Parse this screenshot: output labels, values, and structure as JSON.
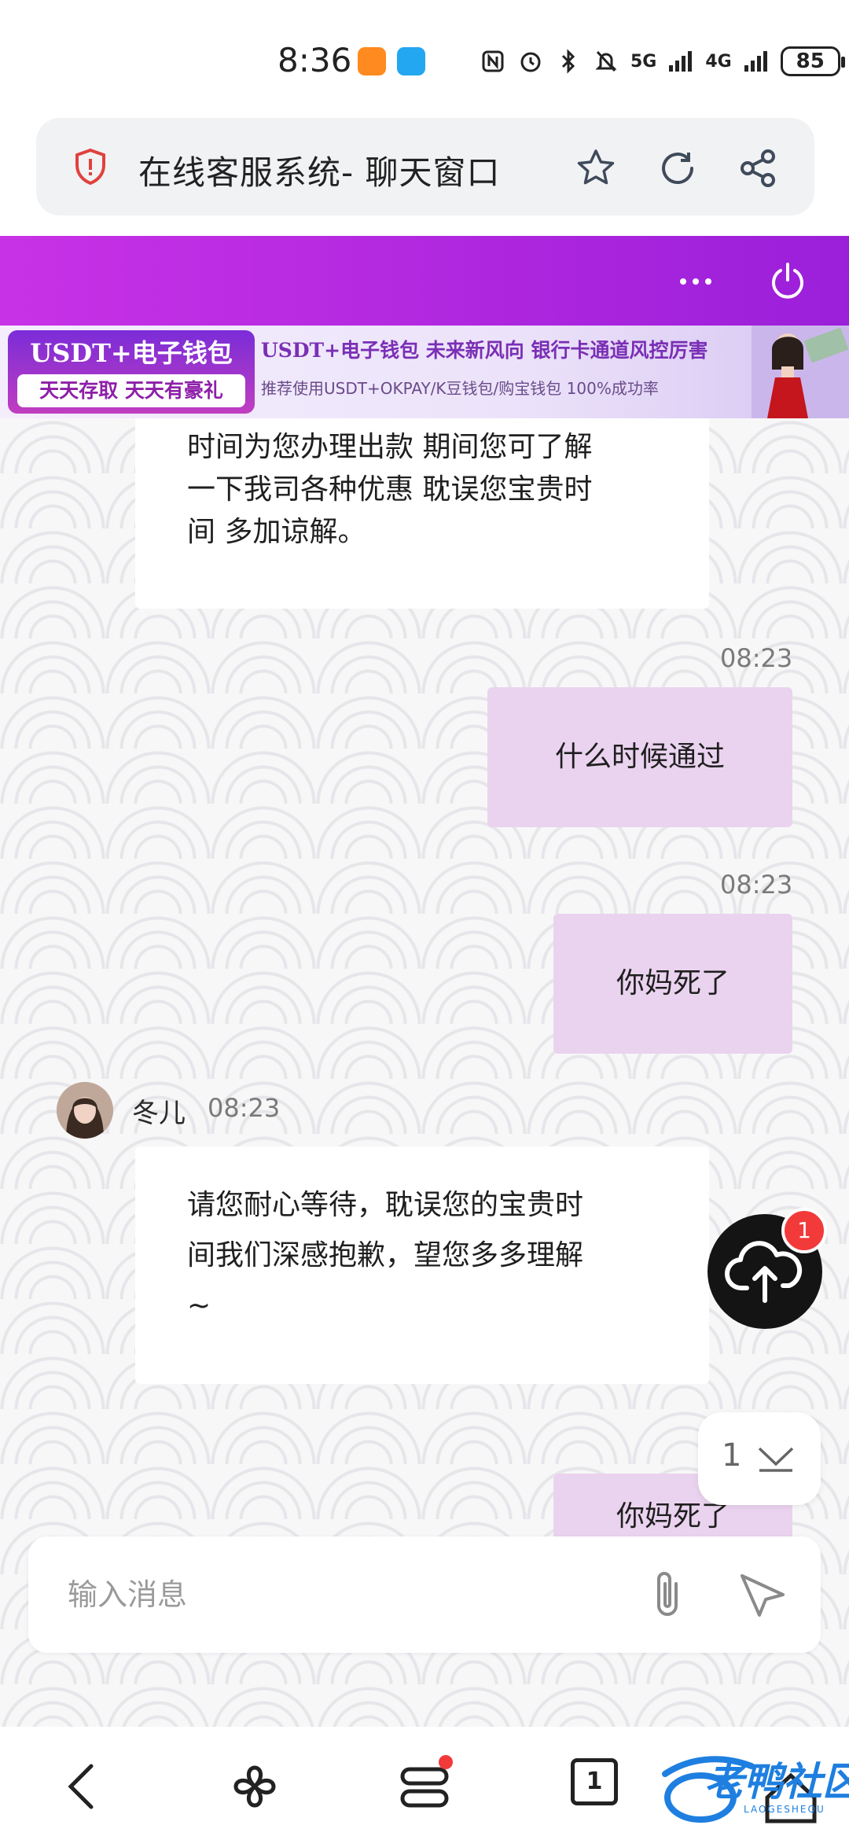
{
  "status_bar": {
    "time": "8:36",
    "network_5g": "5G",
    "network_4g": "4G",
    "battery": "85"
  },
  "browser": {
    "page_title": "在线客服系统- 聊天窗口"
  },
  "ad": {
    "left_title": "USDT+电子钱包",
    "left_sub": "天天存取 天天有豪礼",
    "line1": "USDT+电子钱包   未来新风向   银行卡通道风控厉害",
    "line2": "推荐使用USDT+OKPAY/K豆钱包/购宝钱包    100%成功率"
  },
  "messages": [
    {
      "dir": "in",
      "lines": [
        "时间为您办理出款 期间您可了解",
        "一下我司各种优惠 耽误您宝贵时",
        "间 多加谅解。"
      ]
    },
    {
      "dir": "out",
      "time": "08:23",
      "text": "什么时候通过"
    },
    {
      "dir": "out",
      "time": "08:23",
      "text": "你妈死了"
    },
    {
      "dir": "in",
      "sender": "冬儿",
      "time": "08:23",
      "lines": [
        "请您耐心等待，耽误您的宝贵时",
        "间我们深感抱歉，望您多多理解",
        "~"
      ]
    },
    {
      "dir": "out",
      "text": "你妈死了"
    }
  ],
  "fab": {
    "badge": "1"
  },
  "scroll_down": {
    "count": "1"
  },
  "input": {
    "placeholder": "输入消息"
  },
  "nav": {
    "tab_count": "1"
  },
  "watermark": {
    "text": "老鸭社区",
    "sub": "LAOGESHEQU"
  },
  "colors": {
    "header_start": "#c832e6",
    "header_end": "#9b1fd9",
    "out_bubble": "#ead3ef",
    "badge": "#f23a3a"
  },
  "icons": {
    "security": "shield-icon",
    "bookmark": "star-icon",
    "reload": "reload-icon",
    "share": "share-icon",
    "menu": "more-icon",
    "logout": "power-icon",
    "upload": "cloud-upload-icon",
    "attach": "paperclip-icon",
    "send": "send-icon"
  }
}
